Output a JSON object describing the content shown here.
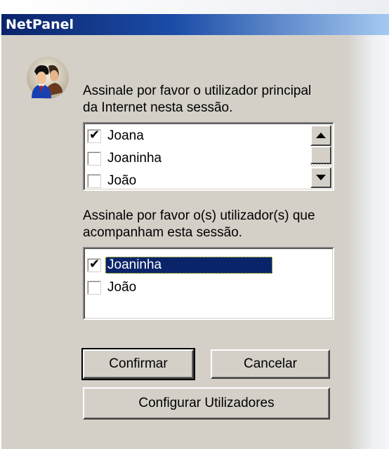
{
  "window": {
    "title": "NetPanel"
  },
  "icons": {
    "avatar": "two-users-icon",
    "check": "checkmark-icon"
  },
  "main_user": {
    "prompt_line1": "Assinale por favor o utilizador principal",
    "prompt_line2": "da Internet nesta sessão.",
    "items": [
      {
        "label": "Joana",
        "checked": true
      },
      {
        "label": "Joaninha",
        "checked": false
      },
      {
        "label": "João",
        "checked": false
      }
    ]
  },
  "companions": {
    "prompt_line1": "Assinale por favor o(s) utilizador(s) que",
    "prompt_line2": "acompanham esta sessão.",
    "items": [
      {
        "label": "Joaninha",
        "checked": true,
        "selected": true
      },
      {
        "label": "João",
        "checked": false,
        "selected": false
      }
    ]
  },
  "buttons": {
    "confirm": "Confirmar",
    "cancel": "Cancelar",
    "configure": "Configurar Utilizadores"
  },
  "colors": {
    "title_start": "#0a246a",
    "title_end": "#a6caf0",
    "selection": "#0a246a",
    "face": "#d4d0c8"
  }
}
